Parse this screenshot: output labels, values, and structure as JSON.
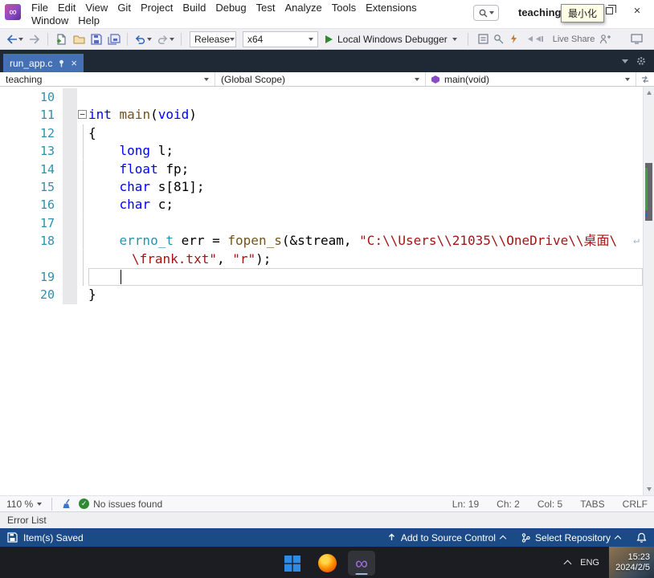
{
  "titlebar": {
    "menus": [
      "File",
      "Edit",
      "View",
      "Git",
      "Project",
      "Build",
      "Debug",
      "Test",
      "Analyze",
      "Tools",
      "Extensions",
      "Window",
      "Help"
    ],
    "solution": "teaching",
    "tooltip": "最小化"
  },
  "toolbar": {
    "configuration": "Release",
    "platform": "x64",
    "run_label": "Local Windows Debugger",
    "live_share": "Live Share"
  },
  "tabs": {
    "active": "run_app.c"
  },
  "navbar": {
    "project": "teaching",
    "scope": "(Global Scope)",
    "member": "main(void)"
  },
  "editor": {
    "lines": [
      {
        "num": "10",
        "seg": []
      },
      {
        "num": "11",
        "fold": true,
        "seg": [
          {
            "c": "kw",
            "t": "int"
          },
          {
            "c": "pl",
            "t": " "
          },
          {
            "c": "fn",
            "t": "main"
          },
          {
            "c": "pl",
            "t": "("
          },
          {
            "c": "kw",
            "t": "void"
          },
          {
            "c": "pl",
            "t": ")"
          }
        ]
      },
      {
        "num": "12",
        "guide": true,
        "seg": [
          {
            "c": "pl",
            "t": "{"
          }
        ]
      },
      {
        "num": "13",
        "guide": true,
        "seg": [
          {
            "c": "pl",
            "t": "    "
          },
          {
            "c": "kw",
            "t": "long"
          },
          {
            "c": "pl",
            "t": " l;"
          }
        ]
      },
      {
        "num": "14",
        "guide": true,
        "seg": [
          {
            "c": "pl",
            "t": "    "
          },
          {
            "c": "kw",
            "t": "float"
          },
          {
            "c": "pl",
            "t": " fp;"
          }
        ]
      },
      {
        "num": "15",
        "guide": true,
        "seg": [
          {
            "c": "pl",
            "t": "    "
          },
          {
            "c": "kw",
            "t": "char"
          },
          {
            "c": "pl",
            "t": " s[81];"
          }
        ]
      },
      {
        "num": "16",
        "guide": true,
        "seg": [
          {
            "c": "pl",
            "t": "    "
          },
          {
            "c": "kw",
            "t": "char"
          },
          {
            "c": "pl",
            "t": " c;"
          }
        ]
      },
      {
        "num": "17",
        "guide": true,
        "seg": []
      },
      {
        "num": "18",
        "guide": true,
        "wrap": true,
        "seg": [
          {
            "c": "pl",
            "t": "    "
          },
          {
            "c": "type",
            "t": "errno_t"
          },
          {
            "c": "pl",
            "t": " err = "
          },
          {
            "c": "fn",
            "t": "fopen_s"
          },
          {
            "c": "pl",
            "t": "(&stream, "
          },
          {
            "c": "str",
            "t": "\"C:\\\\Users\\\\21035\\\\OneDrive\\\\桌面\\"
          }
        ]
      },
      {
        "num": "",
        "guide": true,
        "wrapped": true,
        "seg": [
          {
            "c": "str",
            "t": "\\frank.txt\""
          },
          {
            "c": "pl",
            "t": ", "
          },
          {
            "c": "str",
            "t": "\"r\""
          },
          {
            "c": "pl",
            "t": ");"
          }
        ]
      },
      {
        "num": "19",
        "guide": true,
        "current": true,
        "seg": []
      },
      {
        "num": "20",
        "seg": [
          {
            "c": "pl",
            "t": "}"
          }
        ]
      }
    ]
  },
  "editor_status": {
    "zoom": "110 %",
    "health": "No issues found",
    "ln": "Ln: 19",
    "ch": "Ch: 2",
    "col": "Col: 5",
    "tabs_label": "TABS",
    "eol": "CRLF"
  },
  "panel": {
    "title": "Error List"
  },
  "statusbar": {
    "message": "Item(s) Saved",
    "add_source_control": "Add to Source Control",
    "select_repository": "Select Repository"
  },
  "taskbar": {
    "language": "ENG",
    "time": "15:23",
    "date": "2024/2/5"
  },
  "colors": {
    "accent_tab": "#4470b5",
    "statusbar": "#1a4b87",
    "keyword": "#0000ff",
    "string": "#a31515",
    "type": "#2b91af",
    "function": "#74531f",
    "line_number": "#2b91af"
  }
}
